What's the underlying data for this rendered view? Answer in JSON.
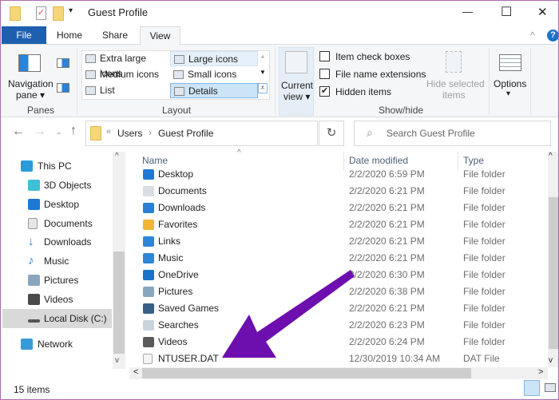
{
  "window": {
    "title": "Guest Profile",
    "controls": {
      "minimize": "—",
      "maximize": "☐",
      "close": "✕"
    }
  },
  "tabs": [
    {
      "label": "File",
      "active": false
    },
    {
      "label": "Home"
    },
    {
      "label": "Share"
    },
    {
      "label": "View",
      "active": true
    }
  ],
  "ribbon": {
    "panes": {
      "navigation_pane": "Navigation\npane ▾",
      "nav_line1": "Navigation",
      "nav_line2": "pane ▾",
      "label": "Panes"
    },
    "layout": {
      "items": [
        "Extra large icons",
        "Large icons",
        "Medium icons",
        "Small icons",
        "List",
        "Details"
      ],
      "selected": "Details",
      "label": "Layout"
    },
    "current_view": {
      "line1": "Current",
      "line2": "view ▾"
    },
    "show_hide": {
      "item_check_boxes": {
        "label": "Item check boxes",
        "checked": false
      },
      "file_name_extensions": {
        "label": "File name extensions",
        "checked": false
      },
      "hidden_items": {
        "label": "Hidden items",
        "checked": true
      },
      "hide_selected_1": "Hide selected",
      "hide_selected_2": "items",
      "label": "Show/hide"
    },
    "options": {
      "label": "Options",
      "arrow": "▾"
    }
  },
  "address": {
    "prefix": "«",
    "crumbs": [
      "Users",
      "Guest Profile"
    ],
    "separator": "›",
    "refresh": "↻"
  },
  "search": {
    "placeholder": "Search Guest Profile"
  },
  "nav": {
    "this_pc": "This PC",
    "items": [
      "3D Objects",
      "Desktop",
      "Documents",
      "Downloads",
      "Music",
      "Pictures",
      "Videos",
      "Local Disk (C:)"
    ],
    "selected": "Local Disk (C:)",
    "network": "Network"
  },
  "columns": {
    "name": "Name",
    "date": "Date modified",
    "type": "Type"
  },
  "files": [
    {
      "name": "Desktop",
      "date": "2/2/2020 6:59 PM",
      "type": "File folder",
      "icon": "desktop",
      "color": "#1e78d6"
    },
    {
      "name": "Documents",
      "date": "2/2/2020 6:21 PM",
      "type": "File folder",
      "icon": "documents",
      "color": "#d8dde3"
    },
    {
      "name": "Downloads",
      "date": "2/2/2020 6:21 PM",
      "type": "File folder",
      "icon": "downloads",
      "color": "#2a7fd4"
    },
    {
      "name": "Favorites",
      "date": "2/2/2020 6:21 PM",
      "type": "File folder",
      "icon": "star",
      "color": "#f2b533"
    },
    {
      "name": "Links",
      "date": "2/2/2020 6:21 PM",
      "type": "File folder",
      "icon": "link",
      "color": "#2f86d8"
    },
    {
      "name": "Music",
      "date": "2/2/2020 6:21 PM",
      "type": "File folder",
      "icon": "music",
      "color": "#2f86d8"
    },
    {
      "name": "OneDrive",
      "date": "2/2/2020 6:30 PM",
      "type": "File folder",
      "icon": "cloud",
      "color": "#1a73c9"
    },
    {
      "name": "Pictures",
      "date": "2/2/2020 6:38 PM",
      "type": "File folder",
      "icon": "pictures",
      "color": "#8aa6bf"
    },
    {
      "name": "Saved Games",
      "date": "2/2/2020 6:21 PM",
      "type": "File folder",
      "icon": "saved-games",
      "color": "#3a5f86"
    },
    {
      "name": "Searches",
      "date": "2/2/2020 6:23 PM",
      "type": "File folder",
      "icon": "search",
      "color": "#c9d4df"
    },
    {
      "name": "Videos",
      "date": "2/2/2020 6:24 PM",
      "type": "File folder",
      "icon": "videos",
      "color": "#5a5a5a"
    },
    {
      "name": "NTUSER.DAT",
      "date": "12/30/2019 10:34 AM",
      "type": "DAT File",
      "icon": "file",
      "color": "#f4f4f4"
    }
  ],
  "status": {
    "count": "15 items"
  },
  "annotation": {
    "arrow_color": "#6c0fae"
  }
}
